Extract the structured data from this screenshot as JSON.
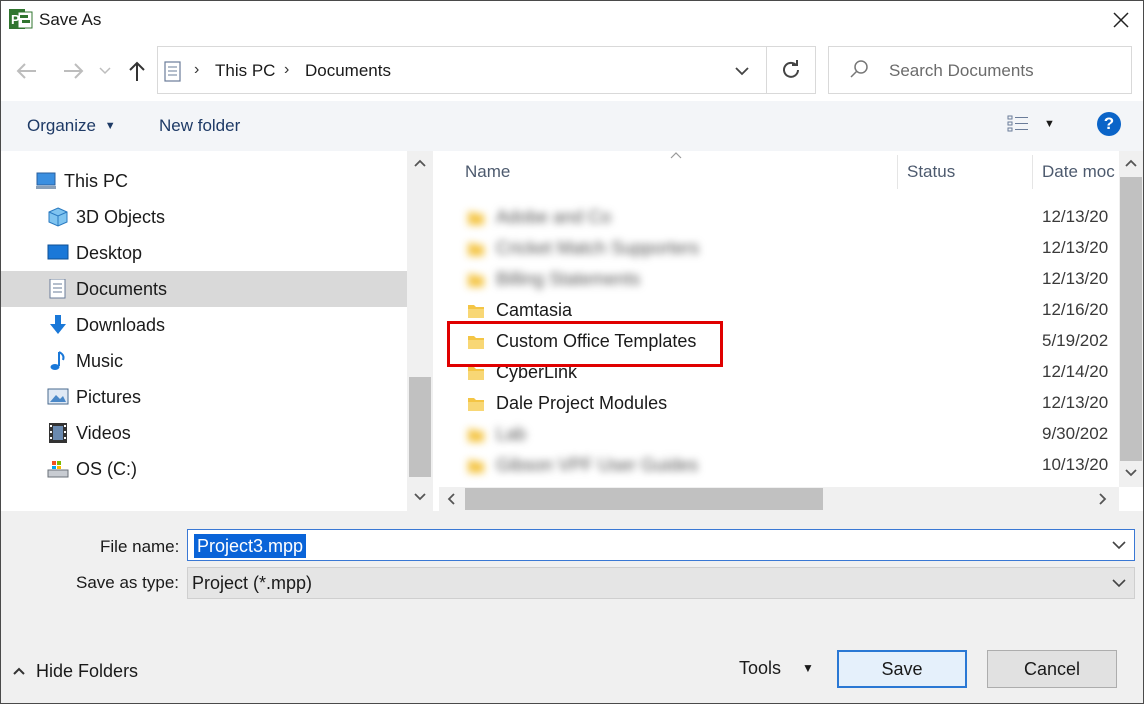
{
  "window": {
    "title": "Save As",
    "app_icon": "project-app-icon",
    "app_icon_letter": "P",
    "close_icon": "close-icon"
  },
  "navigation": {
    "back_icon": "back-arrow-icon",
    "forward_icon": "forward-arrow-icon",
    "recent_icon": "chevron-down-icon",
    "up_icon": "up-arrow-icon",
    "breadcrumb": [
      "This PC",
      "Documents"
    ],
    "refresh_icon": "refresh-icon",
    "search_placeholder": "Search Documents"
  },
  "toolbar": {
    "organize_label": "Organize",
    "new_folder_label": "New folder",
    "view_icon": "details-view-icon",
    "help_label": "?"
  },
  "sidebar": {
    "items": [
      {
        "label": "This PC",
        "icon": "computer-icon",
        "selected": false
      },
      {
        "label": "3D Objects",
        "icon": "cube-icon",
        "selected": false
      },
      {
        "label": "Desktop",
        "icon": "desktop-icon",
        "selected": false
      },
      {
        "label": "Documents",
        "icon": "document-icon",
        "selected": true
      },
      {
        "label": "Downloads",
        "icon": "download-arrow-icon",
        "selected": false
      },
      {
        "label": "Music",
        "icon": "music-note-icon",
        "selected": false
      },
      {
        "label": "Pictures",
        "icon": "picture-icon",
        "selected": false
      },
      {
        "label": "Videos",
        "icon": "film-icon",
        "selected": false
      },
      {
        "label": "OS (C:)",
        "icon": "drive-icon",
        "selected": false
      }
    ]
  },
  "file_list": {
    "columns": [
      "Name",
      "Status",
      "Date moc"
    ],
    "rows": [
      {
        "name": "Adobe and Co",
        "date": "12/13/20",
        "blurred": true
      },
      {
        "name": "Cricket Match Supporters",
        "date": "12/13/20",
        "blurred": true
      },
      {
        "name": "Billing Statements",
        "date": "12/13/20",
        "blurred": true
      },
      {
        "name": "Camtasia",
        "date": "12/16/20",
        "blurred": false
      },
      {
        "name": "Custom Office Templates",
        "date": "5/19/202",
        "blurred": false,
        "highlighted": true
      },
      {
        "name": "CyberLink",
        "date": "12/14/20",
        "blurred": false
      },
      {
        "name": "Dale Project Modules",
        "date": "12/13/20",
        "blurred": false
      },
      {
        "name": "Lab",
        "date": "9/30/202",
        "blurred": true
      },
      {
        "name": "Gibson VPF User Guides",
        "date": "10/13/20",
        "blurred": true
      }
    ]
  },
  "form": {
    "filename_label": "File name:",
    "filename_value": "Project3.mpp",
    "savetype_label": "Save as type:",
    "savetype_value": "Project (*.mpp)"
  },
  "footer": {
    "hide_folders_label": "Hide Folders",
    "tools_label": "Tools",
    "save_label": "Save",
    "cancel_label": "Cancel"
  },
  "colors": {
    "accent": "#0a64d8",
    "folder": "#f4c545",
    "highlight": "#e00000"
  }
}
